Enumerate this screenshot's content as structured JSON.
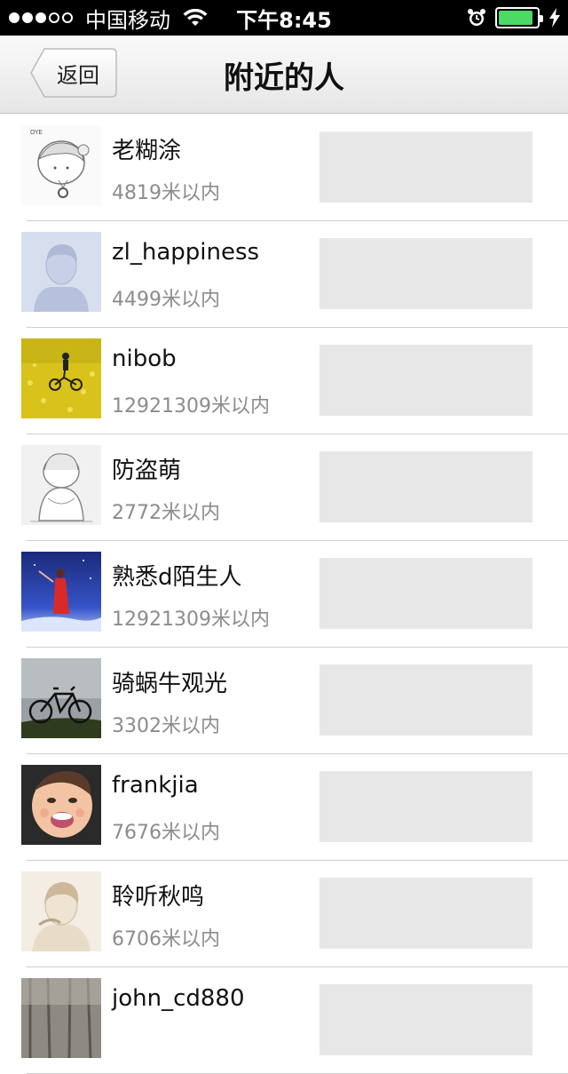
{
  "status_bar": {
    "carrier": "中国移动",
    "time": "下午8:45",
    "signal_bars_filled": 3,
    "signal_bars_total": 5,
    "battery_level": 0.85,
    "battery_color": "#4cd964"
  },
  "nav": {
    "back_label": "返回",
    "title": "附近的人"
  },
  "people": [
    {
      "name": "老糊涂",
      "distance": "4819米以内",
      "avatar": "sketch-girl"
    },
    {
      "name": "zl_happiness",
      "distance": "4499米以内",
      "avatar": "default-silhouette"
    },
    {
      "name": "nibob",
      "distance": "12921309米以内",
      "avatar": "field-cyclist"
    },
    {
      "name": "防盗萌",
      "distance": "2772米以内",
      "avatar": "sketch-kneeling"
    },
    {
      "name": "熟悉d陌生人",
      "distance": "12921309米以内",
      "avatar": "night-figure"
    },
    {
      "name": "骑蜗牛观光",
      "distance": "3302米以内",
      "avatar": "bicycle"
    },
    {
      "name": "frankjia",
      "distance": "7676米以内",
      "avatar": "baby"
    },
    {
      "name": "聆听秋鸣",
      "distance": "6706米以内",
      "avatar": "beige-sketch"
    },
    {
      "name": "john_cd880",
      "distance": "",
      "avatar": "forest"
    }
  ]
}
